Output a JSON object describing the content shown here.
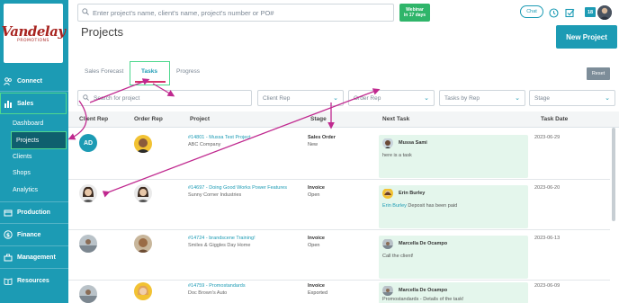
{
  "app": {
    "logo_text": "Vandelay",
    "logo_sub": "PROMOTIONS"
  },
  "header": {
    "search_placeholder": "Enter project's name, client's name, project's number or PO#",
    "webinar_line1": "Webinar",
    "webinar_line2": "in 17 days",
    "chat_label": "Chat",
    "badge_count": "18",
    "page_title": "Projects",
    "new_project_label": "New Project"
  },
  "sidebar": {
    "connect": "Connect",
    "sales": "Sales",
    "sub": [
      "Dashboard",
      "Projects",
      "Clients",
      "Shops",
      "Analytics"
    ],
    "production": "Production",
    "finance": "Finance",
    "management": "Management",
    "resources": "Resources"
  },
  "tabs": {
    "sales_forecast": "Sales Forecast",
    "tasks": "Tasks",
    "progress": "Progress",
    "reset": "Reset"
  },
  "filters": {
    "search_placeholder": "Search for project",
    "client_rep": "Client Rep",
    "order_rep": "Order Rep",
    "tasks_by_rep": "Tasks by Rep",
    "stage": "Stage"
  },
  "columns": {
    "client_rep": "Client Rep",
    "order_rep": "Order Rep",
    "project": "Project",
    "stage": "Stage",
    "next_task": "Next Task",
    "task_date": "Task Date"
  },
  "rows": [
    {
      "client_initials": "AD",
      "project_num": "#14801 - Mussa Test Project",
      "client": "ABC Company",
      "stage": "Sales Order",
      "stage_sub": "New",
      "task_person": "Mussa Sami",
      "task_pre": "",
      "task_text": "here is a task",
      "date": "2023-06-29"
    },
    {
      "client_initials": "",
      "project_num": "#14697 - Doing Good Works Power Features",
      "client": "Sunny Corner Industries",
      "stage": "Invoice",
      "stage_sub": "Open",
      "task_person": "Erin Burley",
      "task_pre": "Erin Burley",
      "task_text": " Deposit has been paid",
      "date": "2023-06-20"
    },
    {
      "client_initials": "",
      "project_num": "#14724 - brandscene Training!",
      "client": "Smiles & Giggles Day Home",
      "stage": "Invoice",
      "stage_sub": "Open",
      "task_person": "Marcella De Ocampo",
      "task_pre": "",
      "task_text": "Call the client!",
      "date": "2023-06-13"
    },
    {
      "client_initials": "",
      "project_num": "#14759 - Promostandards",
      "client": "Doc Brown's Auto",
      "stage": "Invoice",
      "stage_sub": "Exported",
      "task_person": "Marcella De Ocampo",
      "task_pre": "",
      "task_text": "Promostandards - Details of the task!",
      "date": "2023-06-09"
    }
  ],
  "colors": {
    "sidebar": "#1c9bb4",
    "accent": "#1c9bb4",
    "highlight": "#4ed88e",
    "task_bg": "#e4f6ec",
    "arrow": "#c0298f"
  }
}
